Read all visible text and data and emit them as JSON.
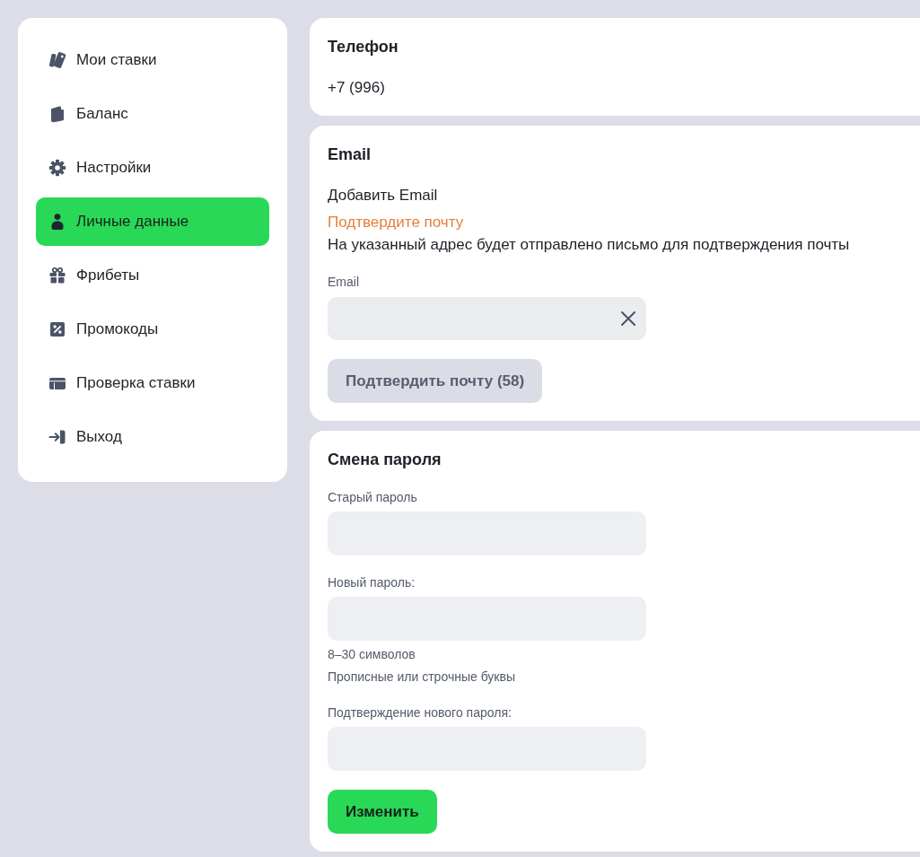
{
  "sidebar": {
    "items": [
      {
        "label": "Мои ставки",
        "selected": false
      },
      {
        "label": "Баланс",
        "selected": false
      },
      {
        "label": "Настройки",
        "selected": false
      },
      {
        "label": "Личные данные",
        "selected": true
      },
      {
        "label": "Фрибеты",
        "selected": false
      },
      {
        "label": "Промокоды",
        "selected": false
      },
      {
        "label": "Проверка ставки",
        "selected": false
      },
      {
        "label": "Выход",
        "selected": false
      }
    ]
  },
  "phone": {
    "title": "Телефон",
    "value": "+7 (996)"
  },
  "email": {
    "title": "Email",
    "add_label": "Добавить Email",
    "warning": "Подтвердите почту",
    "description": "На указанный адрес будет отправлено письмо для подтверждения почты",
    "field": {
      "label": "Email",
      "clearable": true
    },
    "button": {
      "label": "Подтвердить почту (58)",
      "disabled": true
    }
  },
  "password": {
    "title": "Смена пароля",
    "fields": [
      {
        "label": "Старый пароль"
      },
      {
        "label": "Новый пароль:",
        "hints": [
          "8–30 символов",
          "Прописные или строчные буквы"
        ]
      },
      {
        "label": "Подтверждение нового пароля:"
      }
    ],
    "button": {
      "label": "Изменить",
      "disabled": false
    }
  }
}
